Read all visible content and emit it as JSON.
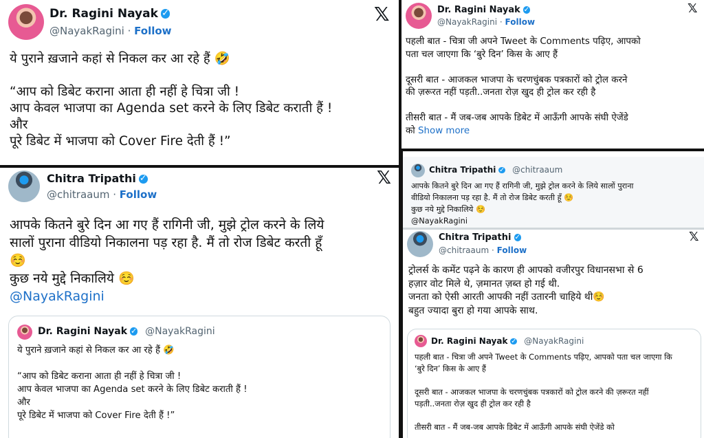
{
  "tweet_a": {
    "name": "Dr. Ragini Nayak",
    "handle": "@NayakRagini",
    "follow": "Follow",
    "x_icon": "x-logo-icon",
    "text": "ये पुराने ख़जाने कहां से निकल कर आ रहे हैं 🤣\n\n“आप को डिबेट कराना आता ही नहीं हे चित्रा जी !\nआप केवल भाजपा का Agenda set करने के लिए डिबेट कराती हैं !\nऔर\nपूरे डिबेट में भाजपा को Cover Fire देती हैं !”"
  },
  "tweet_b": {
    "name": "Dr. Ragini Nayak",
    "handle": "@NayakRagini",
    "follow": "Follow",
    "text": "पहली बात - चित्रा जी अपने Tweet के Comments पढ़िए, आपको\nपता चल जाएगा कि ‘बुरे दिन’ किस के आए हैं\n\nदूसरी बात - आजकल भाजपा के चरणचुंबक पत्रकारों को ट्रोल करने\nकी ज़रूरत नहीं पड़ती..जनता रोज़ खुद ही ट्रोल कर रही है\n\nतीसरी बात - मैं जब-जब आपके डिबेट में आऊँगी आपके संघी ऐजेंडे\nको",
    "show_more": "Show more"
  },
  "tweet_c": {
    "name": "Chitra Tripathi",
    "handle": "@chitraaum",
    "follow": "Follow",
    "text_1": "आपके कितने बुरे दिन आ गए हैं रागिनी जी, मुझे ट्रोल करने के लिये\nसालों पुराना वीडियो निकालना पड़ रहा है. मैं तो रोज डिबेट करती हूँ\n☺️\nकुछ नये मुद्दे निकालिये ☺️",
    "mention": "@NayakRagini",
    "quote": {
      "name": "Dr. Ragini Nayak",
      "handle": "@NayakRagini",
      "text": "ये पुराने ख़जाने कहां से निकल कर आ रहे हैं 🤣\n\n“आप को डिबेट कराना आता ही नहीं हे चित्रा जी !\nआप केवल भाजपा का Agenda set करने के लिए डिबेट कराती हैं !\nऔर\nपूरे डिबेट में भाजपा को Cover Fire देती हैं !”"
    }
  },
  "tweet_d_quote": {
    "name": "Chitra Tripathi",
    "handle": "@chitraaum",
    "text": "आपके कितने बुरे दिन आ गए हैं रागिनी जी, मुझे ट्रोल करने के लिये सालों पुराना\nवीडियो निकालना पड़ रहा है. मैं तो रोज डिबेट करती हूँ ☺️\nकुछ नये मुद्दे निकालिये ☺️\n@NayakRagini"
  },
  "tweet_e": {
    "name": "Chitra Tripathi",
    "handle": "@chitraaum",
    "follow": "Follow",
    "text": "ट्रोलर्स के कमेंट पढ़ने के कारण ही आपको वजीरपुर विधानसभा से 6\nहज़ार वोट मिले थे, ज़मानत ज़ब्त हो गई थी.\nजनता को ऐसी आरती आपकी नहीं उतारनी चाहिये थी☺️\nबहुत ज्यादा बुरा हो गया आपके साथ.",
    "quote": {
      "name": "Dr. Ragini Nayak",
      "handle": "@NayakRagini",
      "text": "पहली बात - चित्रा जी अपने Tweet के Comments पढ़िए, आपको पता चल जाएगा कि\n‘बुरे दिन’ किस के आए हैं\n\nदूसरी बात - आजकल भाजपा के चरणचुंबक पत्रकारों को ट्रोल करने की ज़रूरत नहीं\nपड़ती..जनता रोज़ खुद ही ट्रोल कर रही है\n\nतीसरी बात - मैं जब-जब आपके डिबेट में आऊँगी आपके संघी ऐजेंडे को"
    }
  },
  "colors": {
    "link": "#1d70c8",
    "verified": "#1d9bf0",
    "divider": "#111111"
  }
}
